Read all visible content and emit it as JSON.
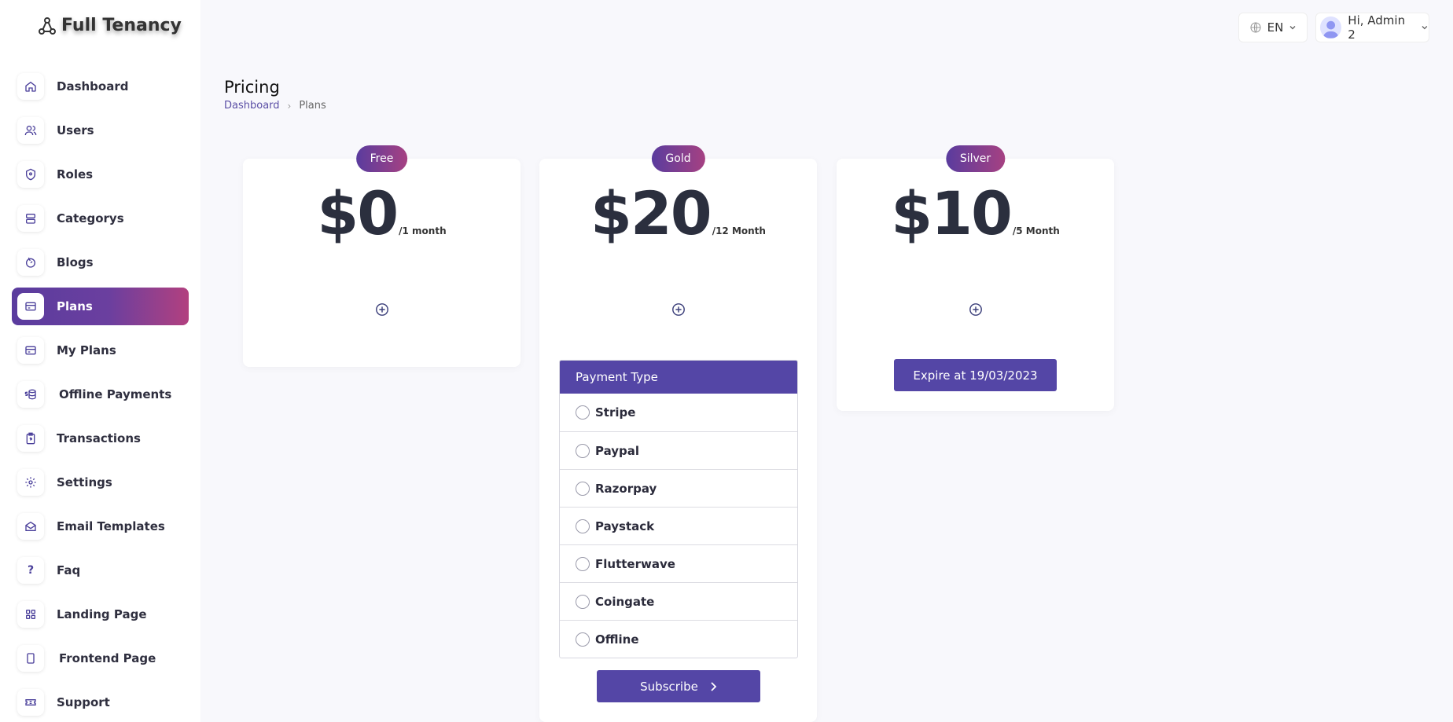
{
  "app": {
    "logo_text": "Full Tenancy"
  },
  "topbar": {
    "language": "EN",
    "greeting": "Hi, Admin 2"
  },
  "sidebar": {
    "items": [
      {
        "label": "Dashboard",
        "icon": "home-icon"
      },
      {
        "label": "Users",
        "icon": "users-icon"
      },
      {
        "label": "Roles",
        "icon": "shield-icon"
      },
      {
        "label": "Categorys",
        "icon": "layers-icon"
      },
      {
        "label": "Blogs",
        "icon": "blog-icon"
      },
      {
        "label": "Plans",
        "icon": "card-icon",
        "active": true
      },
      {
        "label": "My Plans",
        "icon": "card-icon"
      },
      {
        "label": "Offline Payments",
        "icon": "money-icon"
      },
      {
        "label": "Transactions",
        "icon": "clipboard-icon"
      },
      {
        "label": "Settings",
        "icon": "gear-icon"
      },
      {
        "label": "Email Templates",
        "icon": "mail-icon"
      },
      {
        "label": "Faq",
        "icon": "question-icon"
      },
      {
        "label": "Landing Page",
        "icon": "grid-icon"
      },
      {
        "label": "Frontend Page",
        "icon": "page-icon"
      },
      {
        "label": "Support",
        "icon": "ticket-icon"
      }
    ]
  },
  "page": {
    "title": "Pricing",
    "breadcrumb": {
      "root": "Dashboard",
      "current": "Plans"
    }
  },
  "plans": [
    {
      "badge": "Free",
      "price": "$0",
      "period": "/1 month"
    },
    {
      "badge": "Gold",
      "price": "$20",
      "period": "/12 Month",
      "payment": {
        "header": "Payment Type",
        "options": [
          "Stripe",
          "Paypal",
          "Razorpay",
          "Paystack",
          "Flutterwave",
          "Coingate",
          "Offline"
        ],
        "subscribe_label": "Subscribe"
      }
    },
    {
      "badge": "Silver",
      "price": "$10",
      "period": "/5 Month",
      "expire_label": "Expire at 19/03/2023"
    }
  ],
  "colors": {
    "primary": "#5446a6",
    "gradient_start": "#5a3c9e",
    "gradient_end": "#b2407f"
  }
}
